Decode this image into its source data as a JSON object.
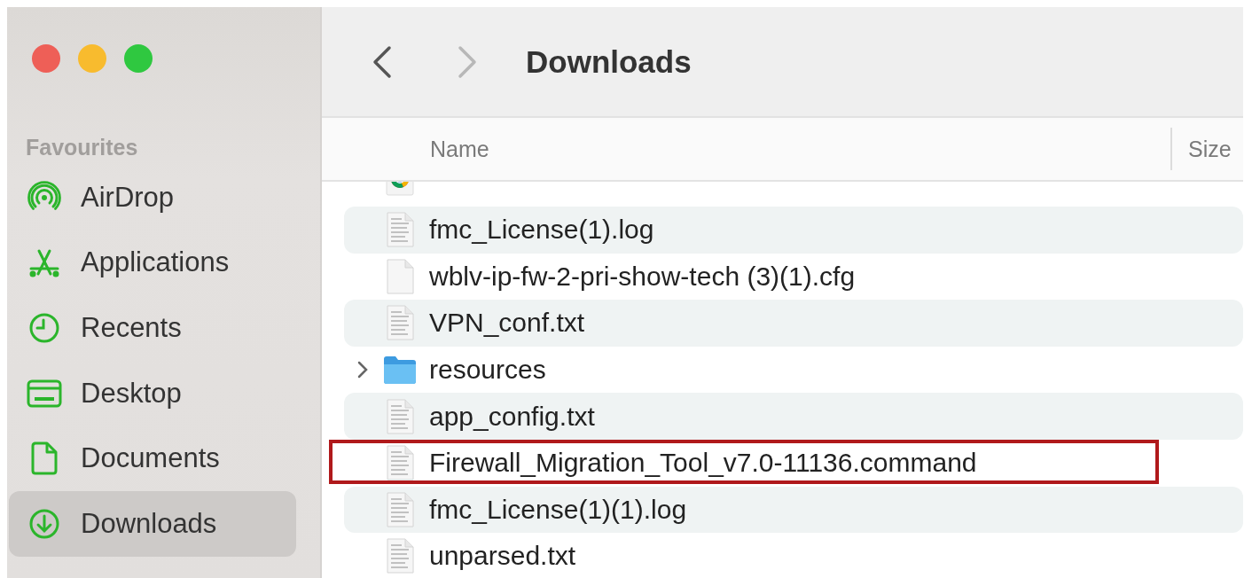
{
  "window": {
    "controls": [
      {
        "kind": "close"
      },
      {
        "kind": "minimize"
      },
      {
        "kind": "zoom"
      }
    ]
  },
  "sidebar": {
    "section": "Favourites",
    "items": [
      {
        "label": "AirDrop",
        "kind": "airdrop",
        "selected": false
      },
      {
        "label": "Applications",
        "kind": "applications",
        "selected": false
      },
      {
        "label": "Recents",
        "kind": "recents",
        "selected": false
      },
      {
        "label": "Desktop",
        "kind": "desktop",
        "selected": false
      },
      {
        "label": "Documents",
        "kind": "documents",
        "selected": false
      },
      {
        "label": "Downloads",
        "kind": "downloads",
        "selected": true
      }
    ]
  },
  "toolbar": {
    "back_disabled": false,
    "forward_disabled": true,
    "title": "Downloads"
  },
  "table": {
    "columns": [
      "Name",
      "Size"
    ],
    "rows": [
      {
        "kind": "chrome"
      },
      {
        "name": "fmc_License(1).log",
        "kind": "text",
        "outlined": false
      },
      {
        "name": "wblv-ip-fw-2-pri-show-tech (3)(1).cfg",
        "kind": "blank",
        "outlined": false
      },
      {
        "name": "VPN_conf.txt",
        "kind": "text",
        "outlined": false
      },
      {
        "name": "resources",
        "kind": "folder",
        "outlined": false
      },
      {
        "name": "app_config.txt",
        "kind": "text",
        "outlined": false
      },
      {
        "name": "Firewall_Migration_Tool_v7.0-11136.command",
        "kind": "text",
        "outlined": true
      },
      {
        "name": "fmc_License(1)(1).log",
        "kind": "text",
        "outlined": false
      },
      {
        "name": "unparsed.txt",
        "kind": "text",
        "outlined": false
      }
    ]
  }
}
